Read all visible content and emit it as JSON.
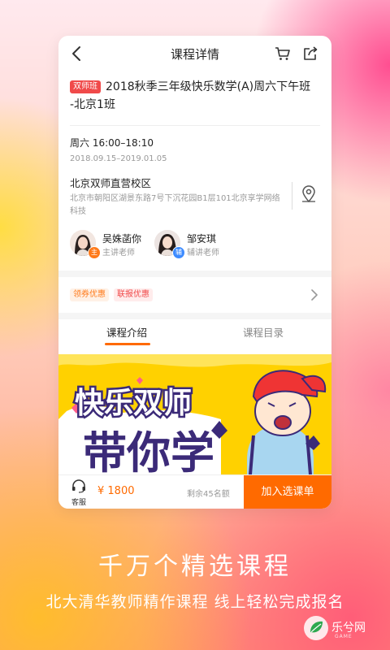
{
  "header": {
    "title": "课程详情"
  },
  "course": {
    "badge": "双师班",
    "title_line1": "2018秋季三年级快乐数学(A)周六下午班",
    "title_line2": "-北京1班",
    "time": "周六 16:00–18:10",
    "dates": "2018.09.15–2019.01.05",
    "campus_name": "北京双师直营校区",
    "campus_addr": "北京市朝阳区湖景东路7号下沉花园B1层101北京享学网络科技"
  },
  "teachers": [
    {
      "name": "吴姝菡你",
      "role": "主讲老师",
      "badge": "主",
      "badge_color": "#ff7a1a"
    },
    {
      "name": "邹安琪",
      "role": "辅讲老师",
      "badge": "辅",
      "badge_color": "#3d8bff"
    }
  ],
  "promos": [
    "领券优惠",
    "联报优惠"
  ],
  "tabs": [
    "课程介绍",
    "课程目录"
  ],
  "bottom": {
    "service_label": "客服",
    "price": "¥ 1800",
    "remaining": "剩余45名额",
    "enroll_label": "加入选课单"
  },
  "banner": {
    "line1": "快乐双师",
    "line2": "带你学"
  },
  "marketing": {
    "title": "千万个精选课程",
    "subtitle": "北大清华教师精作课程 线上轻松完成报名"
  },
  "watermark": {
    "text": "乐兮网",
    "sub": "GAME"
  },
  "colors": {
    "accent": "#ff6a00",
    "badge_red": "#f04a4a"
  }
}
